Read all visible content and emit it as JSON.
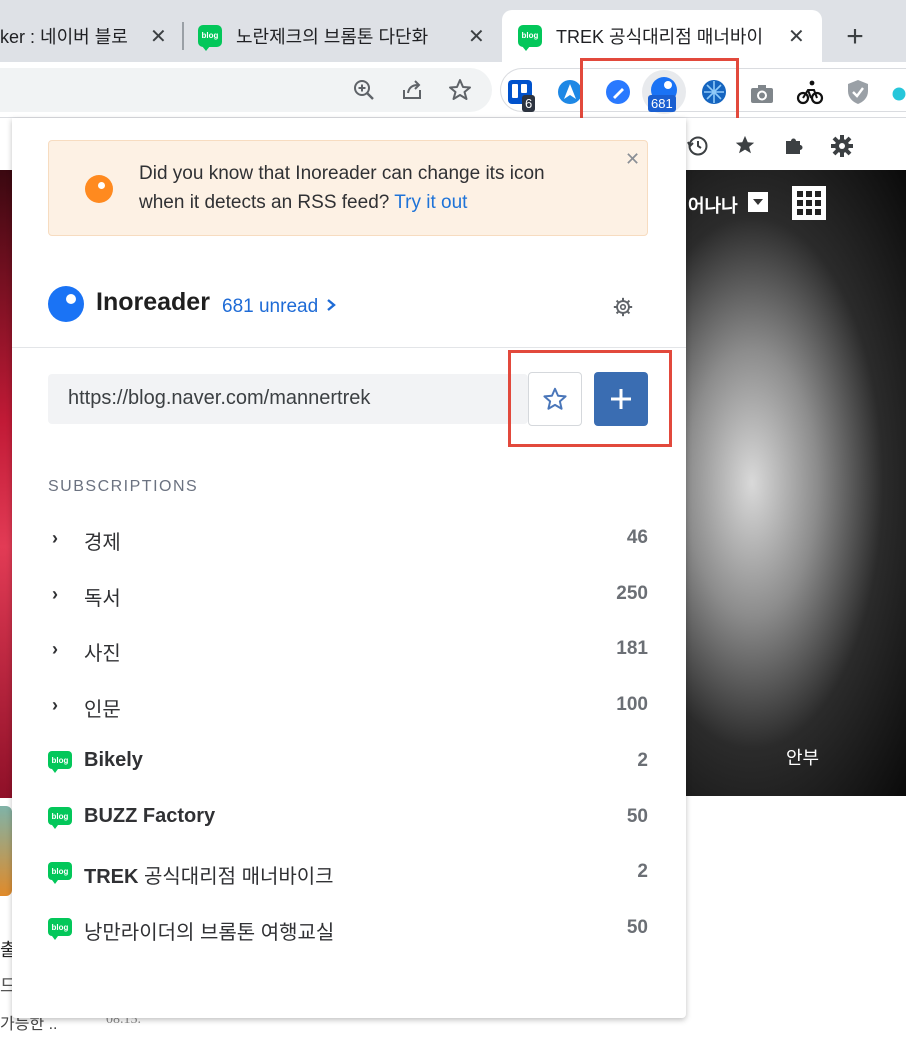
{
  "tabs": [
    {
      "title": "ker : 네이버 블로",
      "favicon": "none"
    },
    {
      "title": "노란제크의 브롬톤 다단화",
      "favicon": "blog-icon"
    },
    {
      "title": "TREK 공식대리점 매너바이",
      "favicon": "blog-icon"
    }
  ],
  "tab_favicon_text": "blog",
  "new_tab_label": "+",
  "toolbar_icons": [
    "zoom-icon",
    "share-icon",
    "bookmark-star-icon"
  ],
  "extensions": {
    "trello_badge": "6",
    "inoreader_badge": "681"
  },
  "page": {
    "right_dropdown": "어나나",
    "right_caption": "안부",
    "left_texts": [
      "출",
      "드",
      "가능한 ..",
      "08.15."
    ]
  },
  "popup": {
    "tip": {
      "text": "Did you know that Inoreader can change its icon when it detects an RSS feed?",
      "link": "Try it out"
    },
    "brand": "Inoreader",
    "unread": "681 unread",
    "url": "https://blog.naver.com/mannertrek",
    "subscriptions_label": "SUBSCRIPTIONS",
    "folders": [
      {
        "name": "경제",
        "count": "46"
      },
      {
        "name": "독서",
        "count": "250"
      },
      {
        "name": "사진",
        "count": "181"
      },
      {
        "name": "인문",
        "count": "100"
      }
    ],
    "feeds": [
      {
        "name_bold": "Bikely",
        "name_rest": "",
        "count": "2"
      },
      {
        "name_bold": "BUZZ Factory",
        "name_rest": "",
        "count": "50"
      },
      {
        "name_bold": "TREK",
        "name_rest": " 공식대리점 매너바이크",
        "count": "2"
      },
      {
        "name_bold": "",
        "name_rest": "낭만라이더의 브롬톤 여행교실",
        "count": "50"
      }
    ]
  },
  "colors": {
    "accent": "#1a73f5",
    "add_button": "#3a6db2",
    "highlight": "#e2493c",
    "tip_bg": "#fdf1e4"
  }
}
